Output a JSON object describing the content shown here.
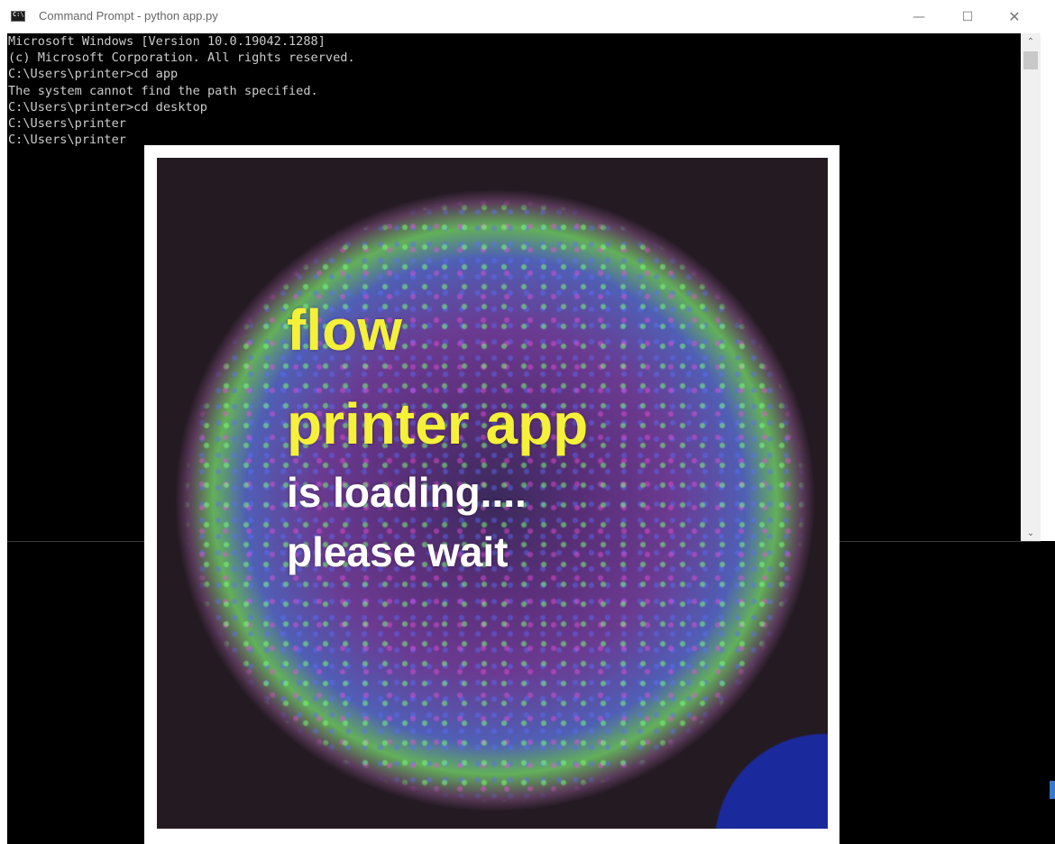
{
  "window": {
    "title": "Command Prompt - python  app.py",
    "icon": "console-icon",
    "controls": {
      "minimize": "—",
      "maximize": "☐",
      "close": "✕"
    }
  },
  "console": {
    "lines": [
      "Microsoft Windows [Version 10.0.19042.1288]",
      "(c) Microsoft Corporation. All rights reserved.",
      "",
      "C:\\Users\\printer>cd app",
      "The system cannot find the path specified.",
      "",
      "C:\\Users\\printer>cd desktop",
      "",
      "C:\\Users\\printer",
      "",
      "C:\\Users\\printer"
    ],
    "text_color": "#cccccc",
    "background": "#000000"
  },
  "scrollbar": {
    "up_arrow": "⌃",
    "down_arrow": "⌄"
  },
  "splash": {
    "line1": "flow",
    "line2": "printer app",
    "line3": "is loading....",
    "line4": "please wait",
    "title_color": "#f5f038",
    "subtitle_color": "#ffffff"
  }
}
